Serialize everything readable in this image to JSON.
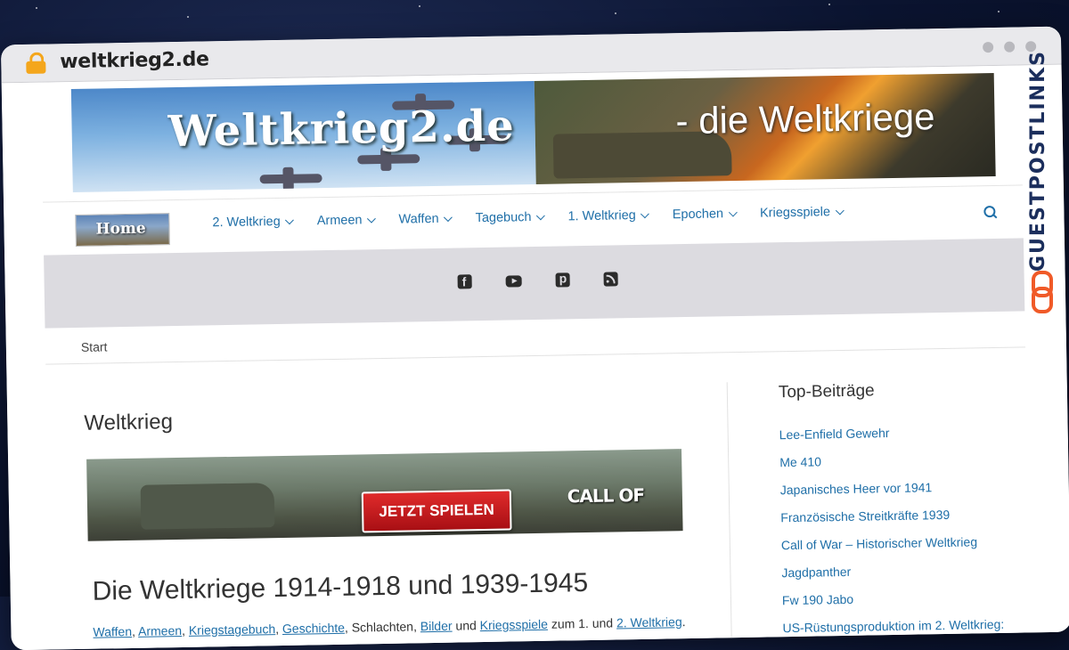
{
  "browser": {
    "url": "weltkrieg2.de"
  },
  "banner": {
    "logo_text": "Weltkrieg2.de",
    "tagline": "- die Weltkriege"
  },
  "nav": {
    "home_label": "Home",
    "items": [
      {
        "label": "2. Weltkrieg"
      },
      {
        "label": "Armeen"
      },
      {
        "label": "Waffen"
      },
      {
        "label": "Tagebuch"
      },
      {
        "label": "1. Weltkrieg"
      },
      {
        "label": "Epochen"
      },
      {
        "label": "Kriegsspiele"
      }
    ]
  },
  "social": [
    "facebook-icon",
    "youtube-icon",
    "pinterest-icon",
    "rss-icon"
  ],
  "breadcrumb": "Start",
  "main": {
    "page_title": "Weltkrieg",
    "ad": {
      "cta": "JETZT SPIELEN",
      "brand": "CALL OF WAR"
    },
    "heading": "Die Weltkriege 1914-1918 und 1939-1945",
    "intro": {
      "link1": "Waffen",
      "sep1": ", ",
      "link2": "Armeen",
      "sep2": ", ",
      "link3": "Kriegstagebuch",
      "sep3": ", ",
      "link4": "Geschichte",
      "text1": ", Schlachten, ",
      "link5": "Bilder",
      "text2": " und ",
      "link6": "Kriegsspiele",
      "text3": " zum 1. und ",
      "link7": "2. Weltkrieg",
      "text4": "."
    }
  },
  "sidebar": {
    "title": "Top-Beiträge",
    "items": [
      "Lee-Enfield Gewehr",
      "Me 410",
      "Japanisches Heer vor 1941",
      "Französische Streitkräfte 1939",
      "Call of War – Historischer Weltkrieg",
      "Jagdpanther",
      "Fw 190 Jabo",
      "US-Rüstungsproduktion im 2. Weltkrieg:"
    ]
  },
  "watermark": {
    "text": "GUESTPOSTLINKS"
  },
  "colors": {
    "link": "#1f6fa8",
    "lock": "#f4a61c",
    "watermark": "#1b2e5c",
    "watermark_icon": "#f05a28"
  }
}
